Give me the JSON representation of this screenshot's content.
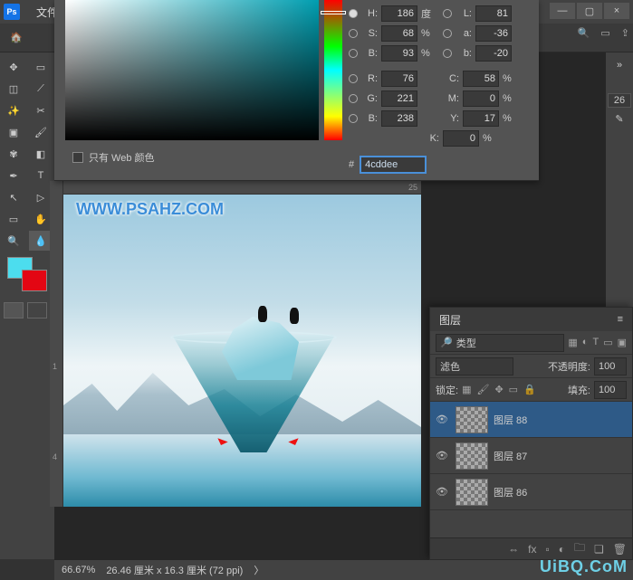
{
  "menu": {
    "file": "文件"
  },
  "win": {
    "min": "—",
    "max": "▢",
    "close": "×"
  },
  "top_right": {
    "search": "🔍",
    "rectview": "▭",
    "share": "⇪"
  },
  "docinfo": {
    "value": "26"
  },
  "color_picker": {
    "H": {
      "label": "H:",
      "value": "186",
      "unit": "度"
    },
    "S": {
      "label": "S:",
      "value": "68",
      "unit": "%"
    },
    "B": {
      "label": "B:",
      "value": "93",
      "unit": "%"
    },
    "L": {
      "label": "L:",
      "value": "81",
      "unit": ""
    },
    "a": {
      "label": "a:",
      "value": "-36",
      "unit": ""
    },
    "b2": {
      "label": "b:",
      "value": "-20",
      "unit": ""
    },
    "R": {
      "label": "R:",
      "value": "76"
    },
    "G": {
      "label": "G:",
      "value": "221"
    },
    "Bc": {
      "label": "B:",
      "value": "238"
    },
    "C": {
      "label": "C:",
      "value": "58",
      "unit": "%"
    },
    "M": {
      "label": "M:",
      "value": "0",
      "unit": "%"
    },
    "Y": {
      "label": "Y:",
      "value": "17",
      "unit": "%"
    },
    "K": {
      "label": "K:",
      "value": "0",
      "unit": "%"
    },
    "hex_label": "#",
    "hex_value": "4cddee",
    "web_only": "只有 Web 颜色"
  },
  "canvas": {
    "watermark": "WWW.PSAHZ.COM"
  },
  "layers_panel": {
    "title": "图层",
    "type_label": "类型",
    "blend_mode": "滤色",
    "opacity_label": "不透明度:",
    "opacity_value": "100",
    "lock_label": "锁定:",
    "fill_label": "填充:",
    "fill_value": "100",
    "layers": [
      {
        "name": "图层 88"
      },
      {
        "name": "图层 87"
      },
      {
        "name": "图层 86"
      }
    ],
    "footer": {
      "fx": "fx",
      "mask": "▫",
      "adjust": "◐",
      "folder": "🗀",
      "new": "❏",
      "trash": "🗑"
    }
  },
  "status": {
    "zoom": "66.67%",
    "doc": "26.46 厘米 x 16.3 厘米 (72 ppi)",
    "arrow": "〉"
  },
  "ruler": {
    "r25": "25",
    "l1": "1",
    "l4": "4"
  },
  "watermark_site": "UiBQ.CoM"
}
